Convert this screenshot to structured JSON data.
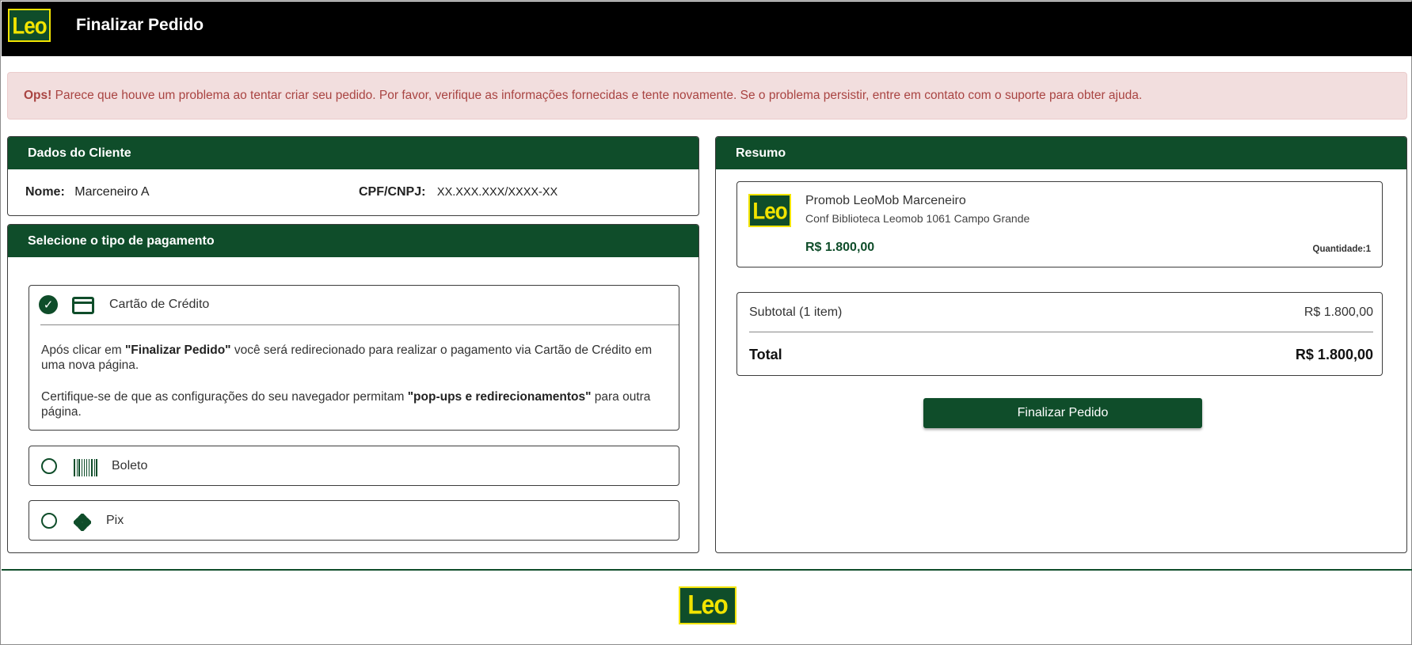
{
  "header": {
    "logo_text": "Leo",
    "title": "Finalizar Pedido"
  },
  "alert": {
    "prefix": "Ops!",
    "message": " Parece que houve um problema ao tentar criar seu pedido. Por favor, verifique as informações fornecidas e tente novamente. Se o problema persistir, entre em contato com o suporte para obter ajuda."
  },
  "client": {
    "heading": "Dados do Cliente",
    "name_label": "Nome:",
    "name_value": "Marceneiro A",
    "doc_label": "CPF/CNPJ:",
    "doc_value": "XX.XXX.XXX/XXXX-XX"
  },
  "payment": {
    "heading": "Selecione o tipo de pagamento",
    "options": [
      {
        "label": "Cartão de Crédito",
        "selected": true,
        "icon": "credit-card-icon",
        "info1_pre": "Após clicar em ",
        "info1_bold": "\"Finalizar Pedido\"",
        "info1_post": " você será redirecionado para realizar o pagamento via Cartão de Crédito em uma nova página.",
        "info2_pre": "Certifique-se de que as configurações do seu navegador permitam ",
        "info2_bold": "\"pop-ups e redirecionamentos\"",
        "info2_post": " para outra página."
      },
      {
        "label": "Boleto",
        "selected": false,
        "icon": "barcode-icon"
      },
      {
        "label": "Pix",
        "selected": false,
        "icon": "pix-icon"
      }
    ]
  },
  "summary": {
    "heading": "Resumo",
    "product": {
      "logo_text": "Leo",
      "name": "Promob LeoMob Marceneiro",
      "description": "Conf Biblioteca Leomob 1061 Campo Grande",
      "price": "R$ 1.800,00",
      "quantity": "Quantidade:1"
    },
    "subtotal_label": "Subtotal (1 item)",
    "subtotal_value": "R$ 1.800,00",
    "total_label": "Total",
    "total_value": "R$ 1.800,00",
    "finalize_label": "Finalizar Pedido"
  },
  "footer": {
    "logo_text": "Leo"
  },
  "colors": {
    "brand_green": "#0f4d2a",
    "brand_yellow": "#f2e400",
    "alert_bg": "#f2dede",
    "alert_text": "#a94442"
  }
}
